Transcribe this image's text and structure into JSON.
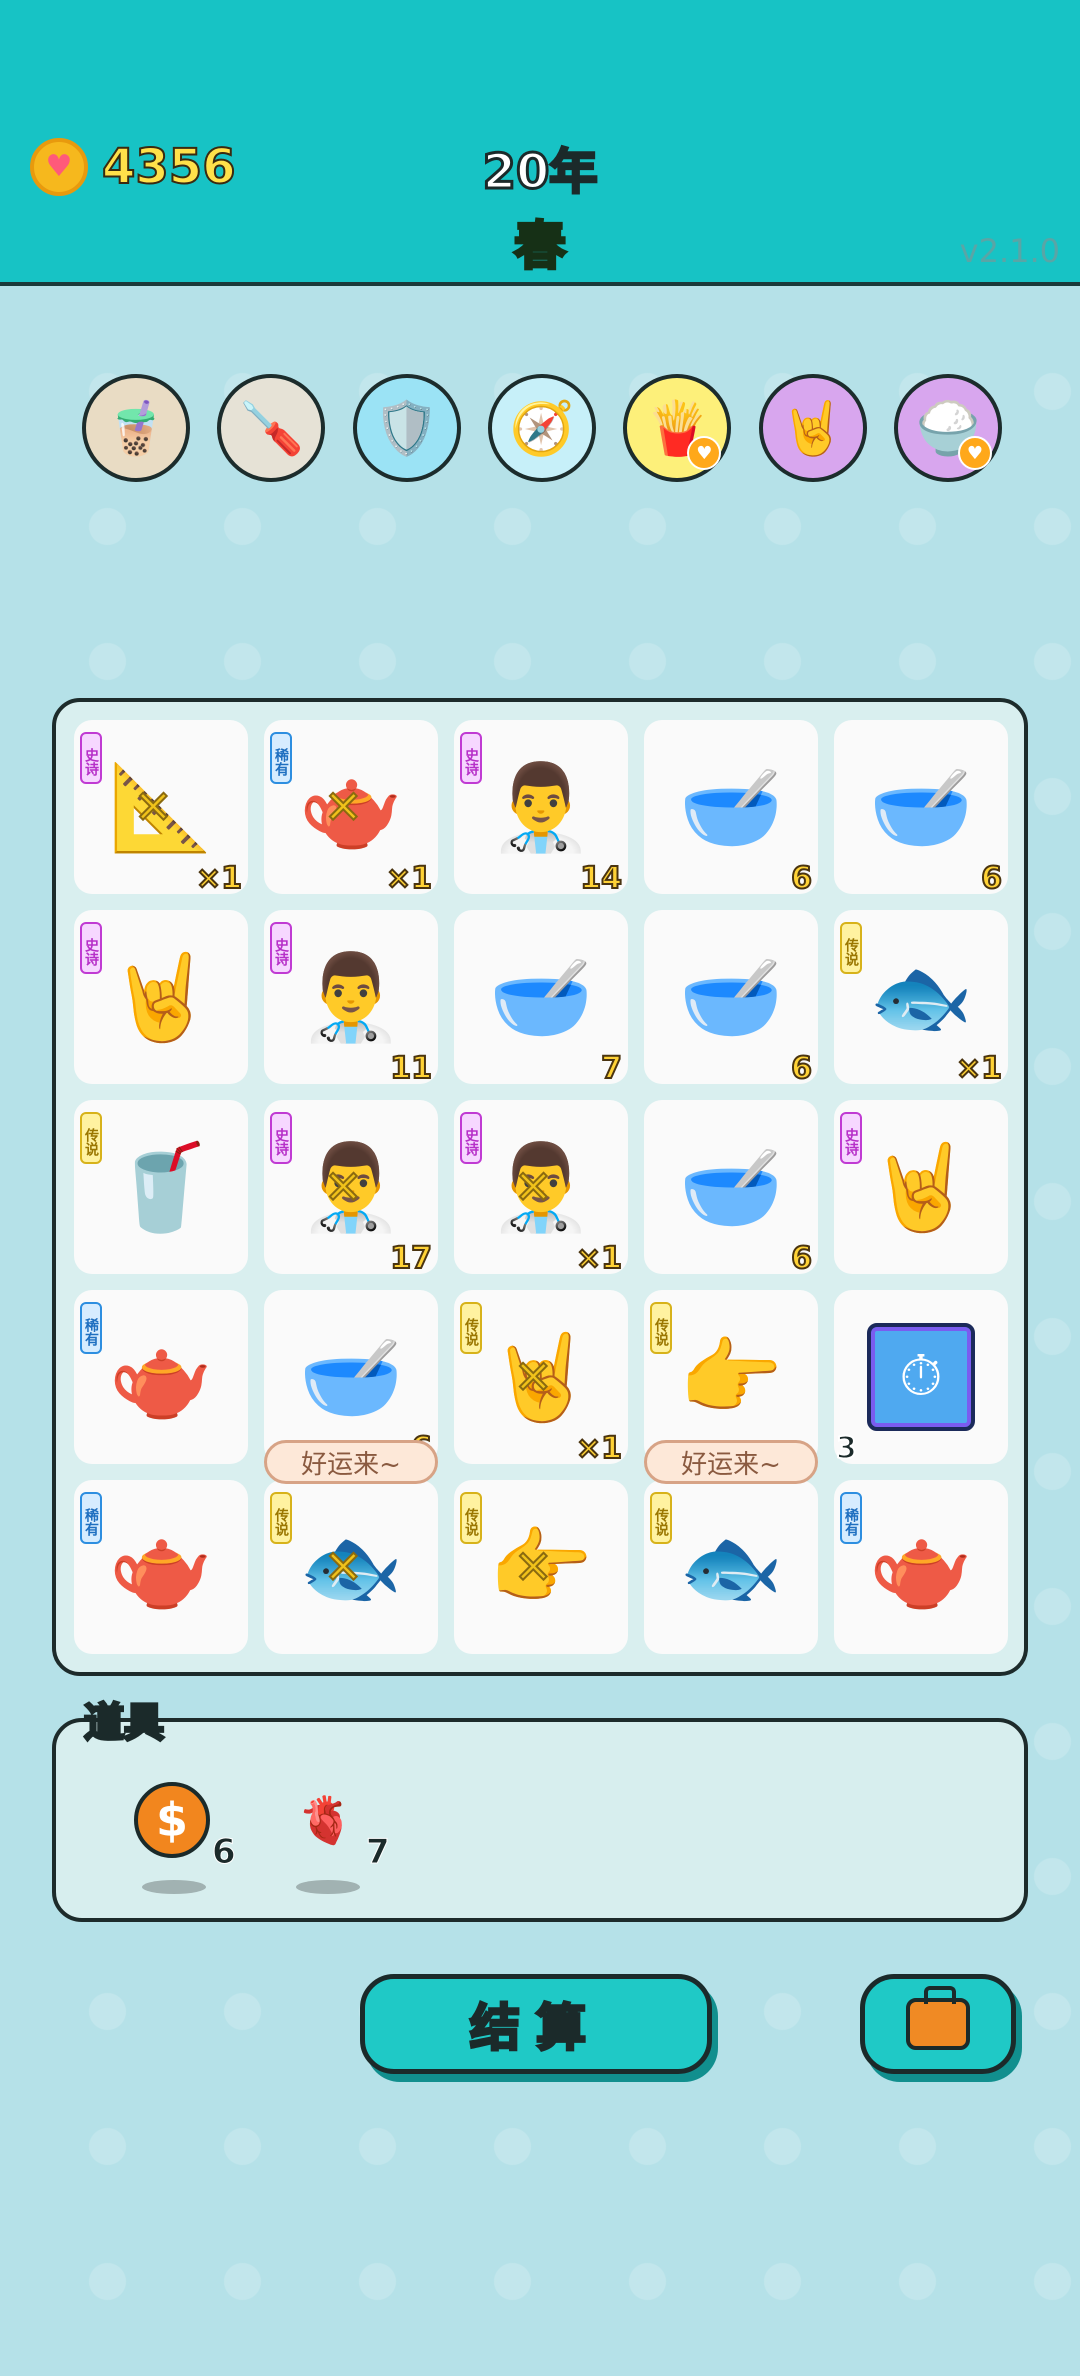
{
  "header": {
    "coins": "4356",
    "year": "20年",
    "season": "春",
    "version": "v2.1.0"
  },
  "tools": [
    {
      "name": "bubble-tea-icon",
      "glyph": "🧋",
      "color": "#e9dcc4"
    },
    {
      "name": "screwdriver-icon",
      "glyph": "🪛",
      "color": "#e6e2d6"
    },
    {
      "name": "shield-wrench-icon",
      "glyph": "🛡️",
      "color": "#9be3f5"
    },
    {
      "name": "compass-icon",
      "glyph": "🧭",
      "color": "#c7f0f9"
    },
    {
      "name": "fries-icon",
      "glyph": "🍟",
      "color": "#fdf07a"
    },
    {
      "name": "rock-hand-icon",
      "glyph": "🤘",
      "color": "#d8a6ee"
    },
    {
      "name": "rice-bowl-icon",
      "glyph": "🍚",
      "color": "#d8a6ee"
    }
  ],
  "board": [
    {
      "rarity": "史诗",
      "r": "epic",
      "icon": "📐",
      "name": "ruler-icon",
      "count": "×1"
    },
    {
      "rarity": "稀有",
      "r": "rare",
      "icon": "🫖",
      "name": "teapot-icon",
      "count": "×1"
    },
    {
      "rarity": "史诗",
      "r": "epic",
      "icon": "👨‍⚕️",
      "name": "green-hat-man-icon",
      "count": "14"
    },
    {
      "rarity": "",
      "r": "",
      "icon": "🥣",
      "name": "soup-bowl-icon",
      "count": "6"
    },
    {
      "rarity": "",
      "r": "",
      "icon": "🥣",
      "name": "soup-bowl-icon",
      "count": "6"
    },
    {
      "rarity": "史诗",
      "r": "epic",
      "icon": "🤘",
      "name": "rock-hand-icon",
      "count": ""
    },
    {
      "rarity": "史诗",
      "r": "epic",
      "icon": "👨‍⚕️",
      "name": "green-hat-man-icon",
      "count": "11"
    },
    {
      "rarity": "",
      "r": "",
      "icon": "🥣",
      "name": "soup-bowl-icon",
      "count": "7"
    },
    {
      "rarity": "",
      "r": "",
      "icon": "🥣",
      "name": "soup-bowl-icon",
      "count": "6"
    },
    {
      "rarity": "传说",
      "r": "legend",
      "icon": "🐟",
      "name": "koi-fish-icon",
      "count": "×1"
    },
    {
      "rarity": "传说",
      "r": "legend",
      "icon": "🥤",
      "name": "bubble-tea-cup-icon",
      "count": ""
    },
    {
      "rarity": "史诗",
      "r": "epic",
      "icon": "👨‍⚕️",
      "name": "green-hat-man-icon",
      "count": "17"
    },
    {
      "rarity": "史诗",
      "r": "epic",
      "icon": "👨‍⚕️",
      "name": "green-hat-man-icon",
      "count": "×1"
    },
    {
      "rarity": "",
      "r": "",
      "icon": "🥣",
      "name": "soup-bowl-icon",
      "count": "6"
    },
    {
      "rarity": "史诗",
      "r": "epic",
      "icon": "🤘",
      "name": "rock-hand-icon",
      "count": ""
    },
    {
      "rarity": "稀有",
      "r": "rare",
      "icon": "🫖",
      "name": "teapot-icon",
      "count": ""
    },
    {
      "rarity": "",
      "r": "",
      "icon": "🥣",
      "name": "soup-bowl-icon",
      "count": "6"
    },
    {
      "rarity": "传说",
      "r": "legend",
      "icon": "🤘",
      "name": "gold-rock-hand-icon",
      "count": "×1"
    },
    {
      "rarity": "传说",
      "r": "legend",
      "icon": "👉",
      "name": "gold-pointing-hand-icon",
      "count": ""
    },
    {
      "rarity": "",
      "r": "",
      "icon": "⏱️",
      "name": "stopwatch-card-icon",
      "count": "3"
    },
    {
      "rarity": "稀有",
      "r": "rare",
      "icon": "🫖",
      "name": "teapot-icon",
      "count": ""
    },
    {
      "rarity": "传说",
      "r": "legend",
      "icon": "🐟",
      "name": "koi-fish-icon",
      "count": "",
      "bubble": "好运来~"
    },
    {
      "rarity": "传说",
      "r": "legend",
      "icon": "👉",
      "name": "gold-pointing-hand-icon",
      "count": ""
    },
    {
      "rarity": "传说",
      "r": "legend",
      "icon": "🐟",
      "name": "koi-fish-icon",
      "count": "",
      "bubble": "好运来~"
    },
    {
      "rarity": "稀有",
      "r": "rare",
      "icon": "🫖",
      "name": "teapot-icon",
      "count": ""
    }
  ],
  "items": {
    "label": "道具",
    "list": [
      {
        "name": "dollar-coin-icon",
        "glyph": "$",
        "bg": "#f2861e",
        "count": "6"
      },
      {
        "name": "liver-icon",
        "glyph": "🫀",
        "bg": "transparent",
        "count": "7"
      }
    ]
  },
  "actions": {
    "settle_label": "结算"
  },
  "colors": {
    "header_bg": "#17c3c5",
    "page_bg": "#b5e1e8",
    "accent_button": "#1fc9c6"
  }
}
